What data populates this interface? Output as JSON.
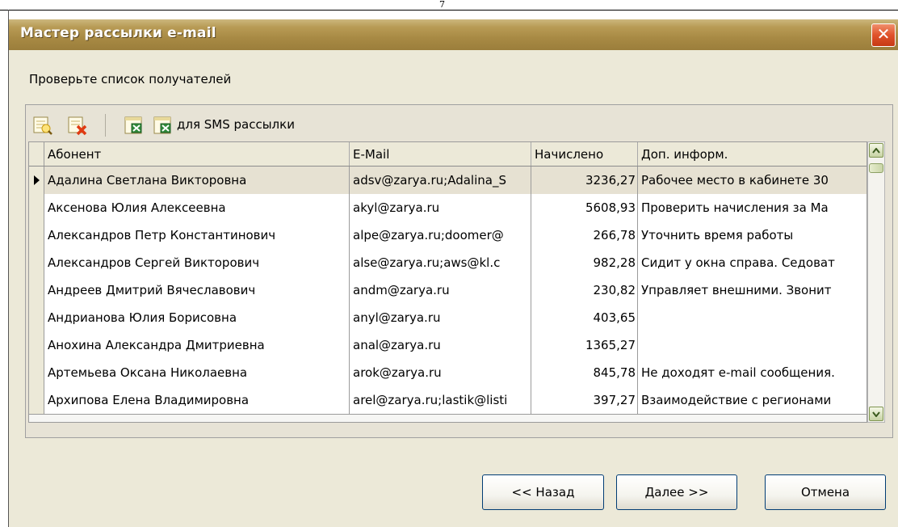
{
  "page_number": "7",
  "window": {
    "title": "Мастер рассылки e-mail",
    "close_glyph": "✕"
  },
  "instruction": "Проверьте список получателей",
  "toolbar": {
    "icons": [
      "add-recipient-icon",
      "delete-recipient-icon",
      "excel-export-icon",
      "excel-export-sms-icon"
    ],
    "sms_label": "для SMS рассылки"
  },
  "grid": {
    "columns": [
      "Абонент",
      "E-Mail",
      "Начислено",
      "Доп. информ."
    ],
    "rows": [
      {
        "name": "Адалина Светлана Викторовна",
        "email": "adsv@zarya.ru;Adalina_S",
        "accrued": "3236,27",
        "info": "Рабочее место в кабинете 30",
        "selected": true
      },
      {
        "name": "Аксенова Юлия Алексеевна",
        "email": "akyl@zarya.ru",
        "accrued": "5608,93",
        "info": "Проверить начисления за Ма",
        "selected": false
      },
      {
        "name": "Александров Петр Константинович",
        "email": "alpe@zarya.ru;doomer@",
        "accrued": "266,78",
        "info": "Уточнить время работы",
        "selected": false
      },
      {
        "name": "Александров Сергей Викторович",
        "email": "alse@zarya.ru;aws@kl.c",
        "accrued": "982,28",
        "info": "Сидит у окна справа. Седоват",
        "selected": false
      },
      {
        "name": "Андреев Дмитрий Вячеславович",
        "email": "andm@zarya.ru",
        "accrued": "230,82",
        "info": "Управляет внешними. Звонит",
        "selected": false
      },
      {
        "name": "Андрианова Юлия Борисовна",
        "email": "anyl@zarya.ru",
        "accrued": "403,65",
        "info": "",
        "selected": false
      },
      {
        "name": "Анохина Александра Дмитриевна",
        "email": "anal@zarya.ru",
        "accrued": "1365,27",
        "info": "",
        "selected": false
      },
      {
        "name": "Артемьева Оксана Николаевна",
        "email": "arok@zarya.ru",
        "accrued": "845,78",
        "info": "Не доходят e-mail сообщения.",
        "selected": false
      },
      {
        "name": "Архипова Елена Владимировна",
        "email": "arel@zarya.ru;lastik@listi",
        "accrued": "397,27",
        "info": "Взаимодействие с регионами",
        "selected": false
      }
    ]
  },
  "buttons": {
    "back": "<< Назад",
    "next": "Далее >>",
    "cancel": "Отмена"
  },
  "colors": {
    "titlebar": "#a88a44",
    "dialog_bg": "#ece9d8",
    "close": "#e0522a",
    "button_border": "#003c74"
  }
}
